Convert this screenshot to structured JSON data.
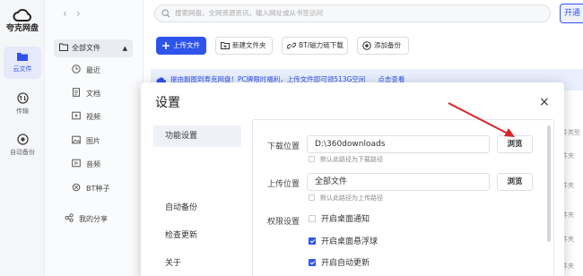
{
  "app": {
    "name": "夸克网盘"
  },
  "rail": [
    {
      "label": "云文件",
      "icon": "folder-icon"
    },
    {
      "label": "传输",
      "icon": "transfer-icon"
    },
    {
      "label": "自动备份",
      "icon": "backup-icon"
    }
  ],
  "nav": {
    "back": "‹",
    "forward": "›"
  },
  "search": {
    "placeholder": "搜索网盘，全网资源资讯，输入网址或从书签访问"
  },
  "open_button": "开通",
  "sidebar": {
    "root": "全部文件",
    "items": [
      {
        "label": "最近",
        "icon": "clock-icon"
      },
      {
        "label": "文档",
        "icon": "document-icon"
      },
      {
        "label": "视频",
        "icon": "video-icon"
      },
      {
        "label": "图片",
        "icon": "image-icon"
      },
      {
        "label": "音频",
        "icon": "audio-icon"
      },
      {
        "label": "BT种子",
        "icon": "bt-icon"
      }
    ],
    "share": "我的分享"
  },
  "toolbar": {
    "upload": "上传文件",
    "new_folder": "新建文件夹",
    "bt_download": "BT/磁力链下载",
    "add_backup": "添加备份"
  },
  "banner": {
    "text": "提由副图到寿克网盘！PC牌限时福利，上传文件即可领513G空间",
    "link": "点击查看"
  },
  "right_column": [
    "件类型",
    "件夹",
    "件夹",
    "件夹",
    "件夹",
    "件夹",
    "件夹"
  ],
  "dialog": {
    "title": "设置",
    "close": "×",
    "nav": [
      "功能设置",
      "自动备份",
      "检查更新",
      "关于"
    ],
    "download": {
      "label": "下载位置",
      "value": "D:\\360downloads",
      "browse": "浏览",
      "default_hint": "默认此路径为下载路径"
    },
    "upload": {
      "label": "上传位置",
      "value": "全部文件",
      "browse": "浏览",
      "default_hint": "默认此路径为上传路径"
    },
    "permissions": {
      "label": "权限设置",
      "options": [
        {
          "label": "开启桌面通知",
          "checked": false
        },
        {
          "label": "开启桌面悬浮球",
          "checked": true
        },
        {
          "label": "开启自动更新",
          "checked": true
        }
      ]
    }
  },
  "colors": {
    "accent": "#2f54eb",
    "annotation_arrow": "#d9262c"
  }
}
